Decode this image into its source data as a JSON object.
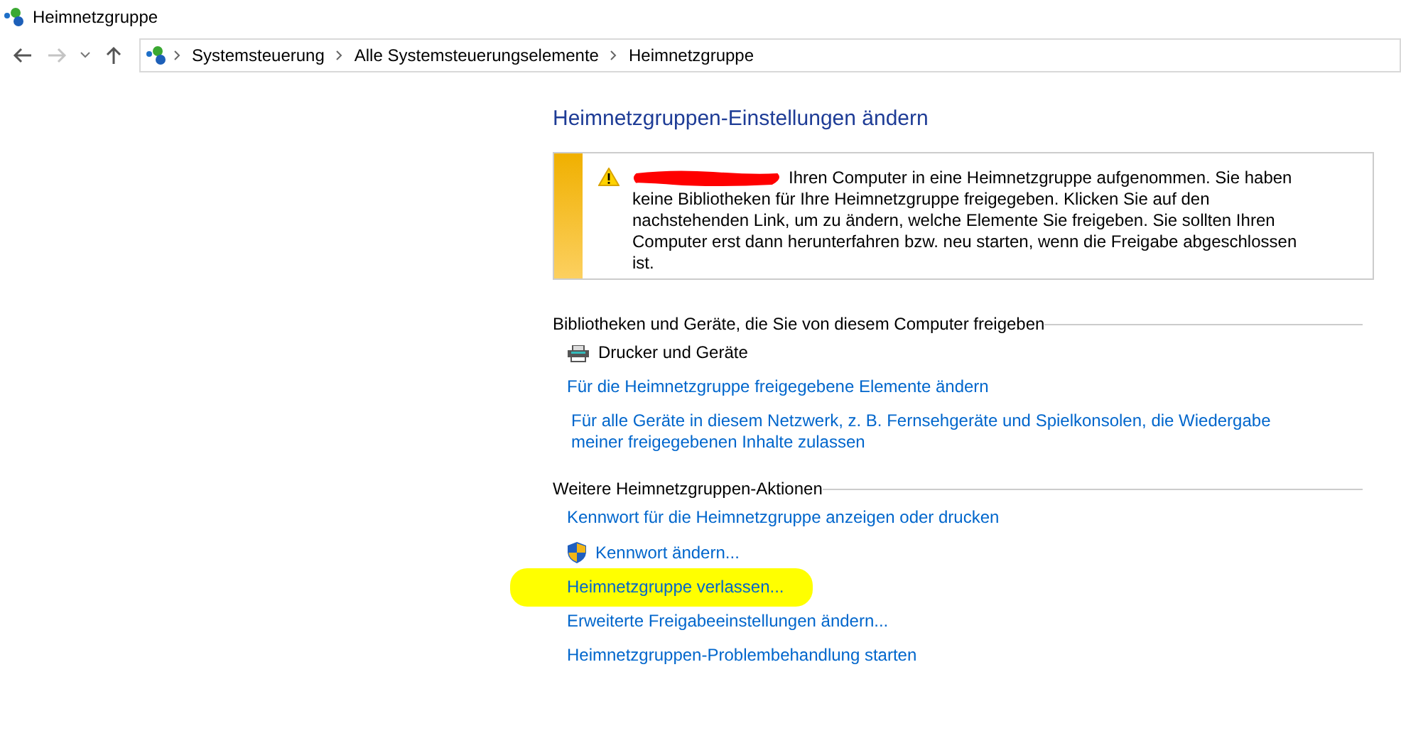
{
  "window": {
    "title": "Heimnetzgruppe"
  },
  "breadcrumb": [
    "Systemsteuerung",
    "Alle Systemsteuerungselemente",
    "Heimnetzgruppe"
  ],
  "heading": "Heimnetzgruppen-Einstellungen ändern",
  "notice": {
    "redacted": true,
    "text": "Ihren Computer in eine Heimnetzgruppe aufgenommen. Sie haben keine Bibliotheken für Ihre Heimnetzgruppe freigegeben. Klicken Sie auf den nachstehenden Link, um zu ändern, welche Elemente Sie freigeben. Sie sollten Ihren Computer erst dann herunterfahren bzw. neu starten, wenn die Freigabe abgeschlossen ist."
  },
  "sections": [
    {
      "title": "Bibliotheken und Geräte, die Sie von diesem Computer freigeben",
      "items": [
        {
          "kind": "device",
          "label": "Drucker und Geräte",
          "highlighted": false
        },
        {
          "kind": "link",
          "label": "Für die Heimnetzgruppe freigegebene Elemente ändern",
          "highlighted": false
        },
        {
          "kind": "link",
          "label": "Für alle Geräte in diesem Netzwerk, z. B. Fernsehgeräte und Spielkonsolen, die Wiedergabe meiner freigegebenen Inhalte zulassen",
          "highlighted": false
        }
      ]
    },
    {
      "title": "Weitere Heimnetzgruppen-Aktionen",
      "items": [
        {
          "kind": "link",
          "label": "Kennwort für die Heimnetzgruppe anzeigen oder drucken",
          "highlighted": false
        },
        {
          "kind": "shield-link",
          "label": "Kennwort ändern...",
          "highlighted": false
        },
        {
          "kind": "link",
          "label": "Heimnetzgruppe verlassen...",
          "highlighted": true
        },
        {
          "kind": "link",
          "label": "Erweiterte Freigabeeinstellungen ändern...",
          "highlighted": false
        },
        {
          "kind": "link",
          "label": "Heimnetzgruppen-Problembehandlung starten",
          "highlighted": false
        }
      ]
    }
  ]
}
